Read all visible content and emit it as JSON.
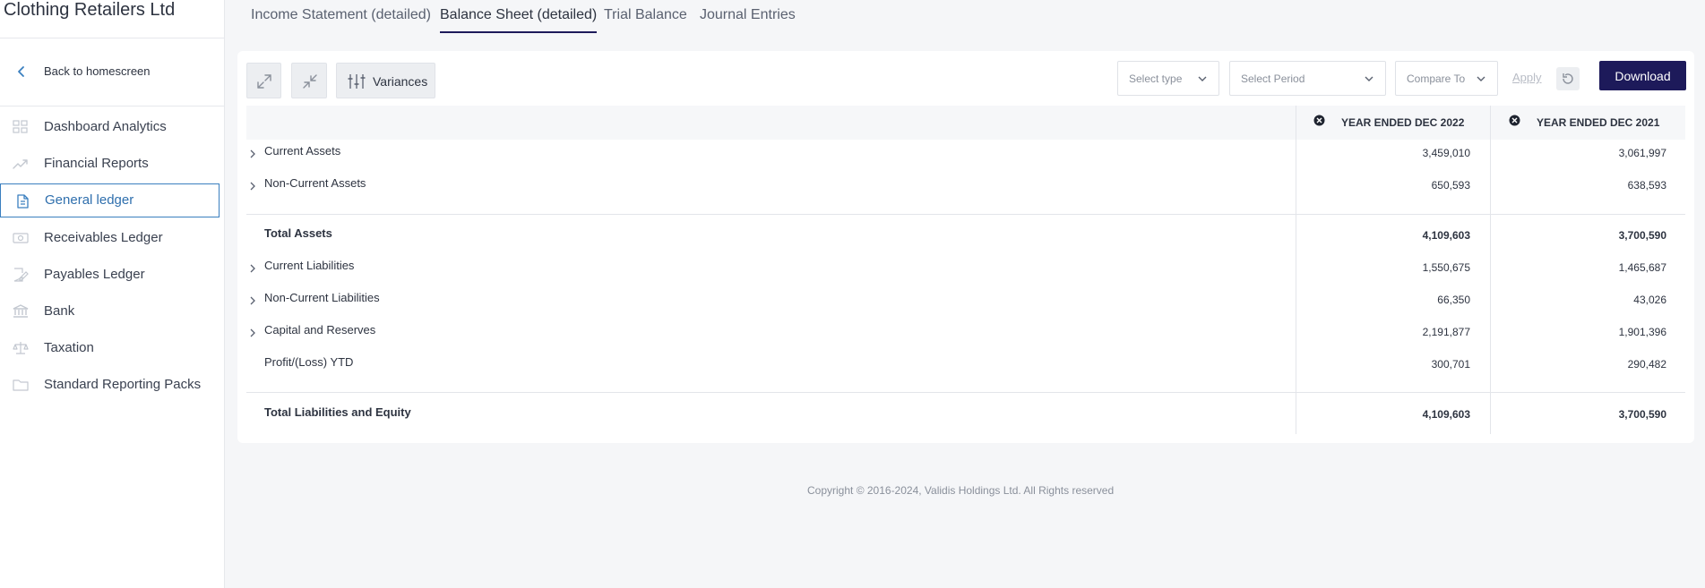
{
  "sidebar": {
    "company": "Clothing Retailers Ltd",
    "back_label": "Back to homescreen",
    "items": [
      {
        "label": "Dashboard Analytics",
        "icon": "grid-icon"
      },
      {
        "label": "Financial Reports",
        "icon": "trend-up-icon"
      },
      {
        "label": "General ledger",
        "icon": "document-icon",
        "active": true
      },
      {
        "label": "Receivables Ledger",
        "icon": "cash-icon"
      },
      {
        "label": "Payables Ledger",
        "icon": "pen-document-icon"
      },
      {
        "label": "Bank",
        "icon": "bank-icon"
      },
      {
        "label": "Taxation",
        "icon": "scales-icon"
      },
      {
        "label": "Standard Reporting Packs",
        "icon": "folder-icon"
      }
    ]
  },
  "tabs": [
    {
      "label": "Income Statement (detailed)"
    },
    {
      "label": "Balance Sheet (detailed)",
      "active": true
    },
    {
      "label": "Trial Balance"
    },
    {
      "label": "Journal Entries"
    }
  ],
  "toolbar": {
    "variances_label": "Variances",
    "select_type_placeholder": "Select type",
    "select_period_placeholder": "Select Period",
    "compare_to_placeholder": "Compare To",
    "apply_label": "Apply",
    "download_label": "Download"
  },
  "table": {
    "columns": [
      "YEAR ENDED DEC 2022",
      "YEAR ENDED DEC 2021"
    ],
    "rows": [
      {
        "label": "Current Assets",
        "v2022": "3,459,010",
        "v2021": "3,061,997"
      },
      {
        "label": "Non-Current Assets",
        "v2022": "650,593",
        "v2021": "638,593"
      },
      {
        "label": "Total Assets",
        "v2022": "4,109,603",
        "v2021": "3,700,590"
      },
      {
        "label": "Current Liabilities",
        "v2022": "1,550,675",
        "v2021": "1,465,687"
      },
      {
        "label": "Non-Current Liabilities",
        "v2022": "66,350",
        "v2021": "43,026"
      },
      {
        "label": "Capital and Reserves",
        "v2022": "2,191,877",
        "v2021": "1,901,396"
      },
      {
        "label": "Profit/(Loss) YTD",
        "v2022": "300,701",
        "v2021": "290,482"
      },
      {
        "label": "Total Liabilities and Equity",
        "v2022": "4,109,603",
        "v2021": "3,700,590"
      }
    ]
  },
  "footer": {
    "copyright": "Copyright © 2016-2024, Validis Holdings Ltd. All Rights reserved"
  },
  "colors": {
    "primary": "#1d1a5a",
    "active_nav": "#2f6fad",
    "background": "#f5f6f8"
  }
}
